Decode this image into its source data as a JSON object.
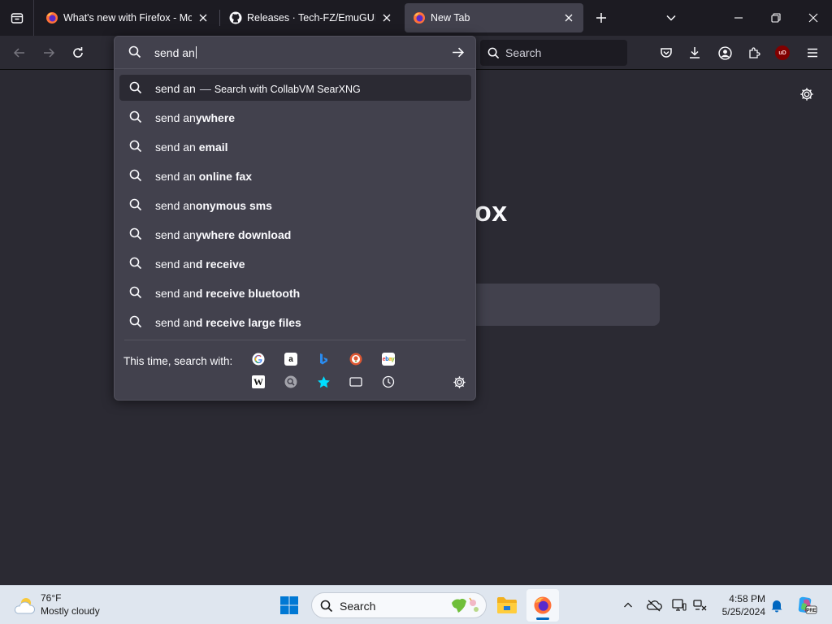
{
  "tabs": [
    {
      "title": "What's new with Firefox - More",
      "active": false,
      "favicon": "firefox-icon"
    },
    {
      "title": "Releases · Tech-FZ/EmuGUI-Pre",
      "active": false,
      "favicon": "github-icon"
    },
    {
      "title": "New Tab",
      "active": true,
      "favicon": "firefox-icon"
    }
  ],
  "navbar": {
    "search_placeholder": "Search",
    "extension_badge": "uD"
  },
  "newtab": {
    "brand_partial": "ox"
  },
  "urlbar": {
    "typed_value": "send an",
    "results": [
      {
        "typed": "send an",
        "completion": "",
        "separator": "—",
        "action": "Search with CollabVM SearXNG",
        "selected": true
      },
      {
        "typed": "send an",
        "completion": "ywhere"
      },
      {
        "typed": "send an ",
        "completion": "email"
      },
      {
        "typed": "send an ",
        "completion": "online fax"
      },
      {
        "typed": "send an",
        "completion": "onymous sms"
      },
      {
        "typed": "send an",
        "completion": "ywhere download"
      },
      {
        "typed": "send an",
        "completion": "d receive"
      },
      {
        "typed": "send an",
        "completion": "d receive bluetooth"
      },
      {
        "typed": "send an",
        "completion": "d receive large files"
      }
    ],
    "oneoff_label": "This time, search with:",
    "engines": [
      "google-icon",
      "amazon-icon",
      "bing-icon",
      "duckduckgo-icon",
      "ebay-icon",
      "wikipedia-icon",
      "searxng-icon",
      "bookmarks-icon",
      "tabs-icon",
      "history-icon"
    ]
  },
  "taskbar": {
    "weather_temp": "76°F",
    "weather_condition": "Mostly cloudy",
    "search_placeholder": "Search",
    "time": "4:58 PM",
    "date": "5/25/2024"
  },
  "colors": {
    "chrome_dark": "#1c1b22",
    "toolbar": "#2b2a33",
    "panel": "#42414d",
    "firefox_orange": "#ff7139",
    "windows_blue": "#0067c0"
  }
}
